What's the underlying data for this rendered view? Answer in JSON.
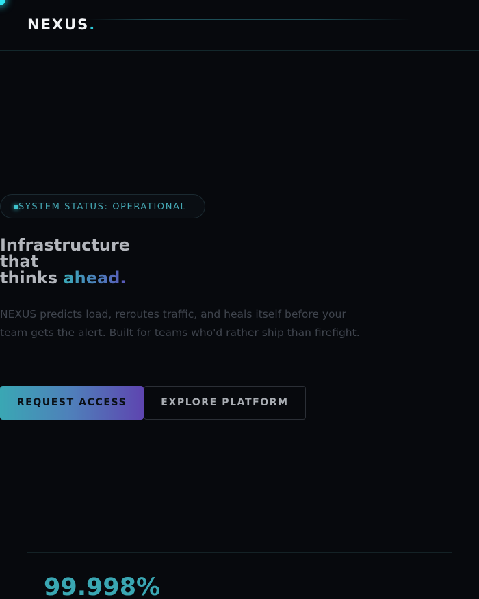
{
  "header": {
    "logo_text": "NEXUS",
    "logo_dot": "."
  },
  "hero": {
    "status_badge": "SYSTEM STATUS: OPERATIONAL",
    "headline_lines": [
      "Infrastructure",
      "that",
      "thinks "
    ],
    "headline_accent": "ahead.",
    "description": "NEXUS predicts load, reroutes traffic, and heals itself before your team gets the alert. Built for teams who'd rather ship than firefight.",
    "primary_button": "REQUEST ACCESS",
    "secondary_button": "EXPLORE PLATFORM"
  },
  "stats": [
    {
      "value": "99.998%"
    }
  ],
  "colors": {
    "background": "#07090d",
    "accent_cyan": "#3aa7b4",
    "accent_violet": "#5e45b0",
    "text_primary": "#f2f4f6",
    "text_muted": "#3f444d"
  }
}
